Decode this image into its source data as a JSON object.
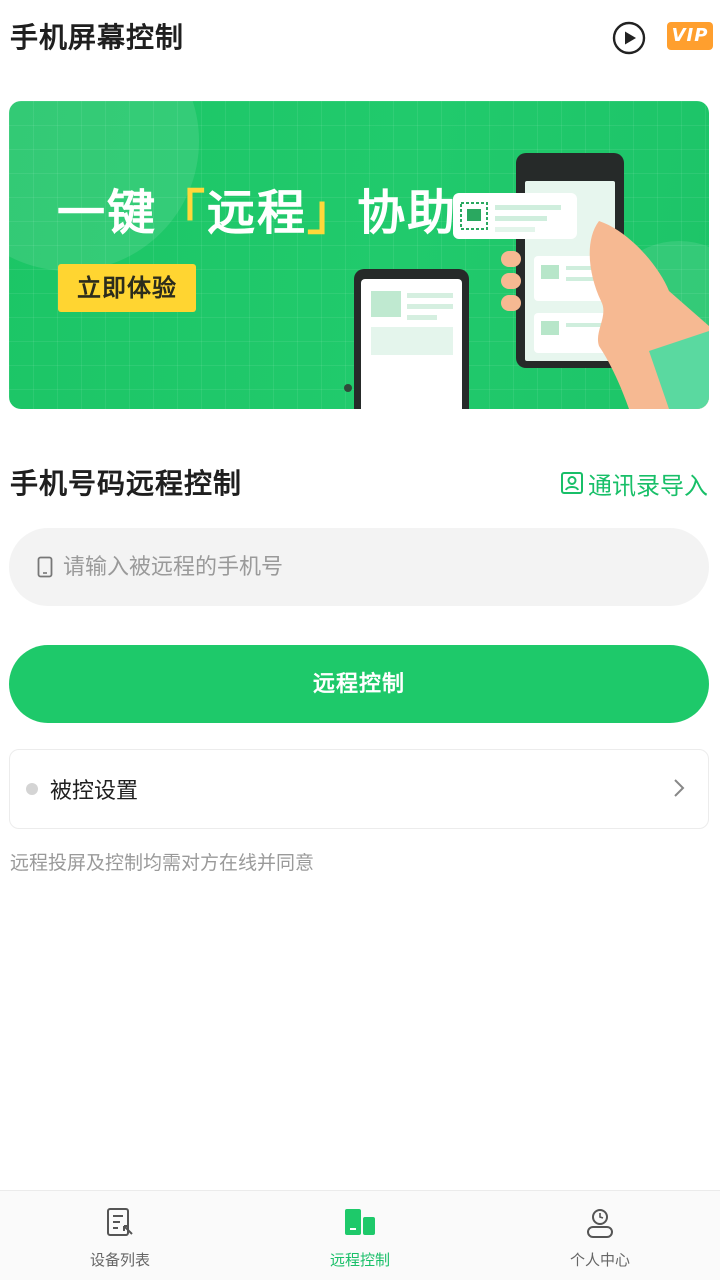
{
  "header": {
    "title": "手机屏幕控制",
    "vip_label": "VIP",
    "play_icon": "play-circle-icon"
  },
  "banner": {
    "title_prefix": "一键",
    "title_open": "「",
    "title_highlight": "远程",
    "title_close": "」",
    "title_suffix": "协助",
    "cta_label": "立即体验"
  },
  "remote": {
    "section_title": "手机号码远程控制",
    "contacts_label": "通讯录导入",
    "phone_placeholder": "请输入被远程的手机号",
    "phone_value": "",
    "submit_label": "远程控制"
  },
  "settings": {
    "label": "被控设置"
  },
  "hint": "远程投屏及控制均需对方在线并同意",
  "tabbar": {
    "items": [
      {
        "label": "设备列表",
        "icon": "device-list-icon",
        "active": false
      },
      {
        "label": "远程控制",
        "icon": "remote-control-icon",
        "active": true
      },
      {
        "label": "个人中心",
        "icon": "profile-icon",
        "active": false
      }
    ]
  },
  "colors": {
    "accent": "#1ec96a",
    "vip": "#ff9f2e",
    "cta": "#ffd531"
  }
}
